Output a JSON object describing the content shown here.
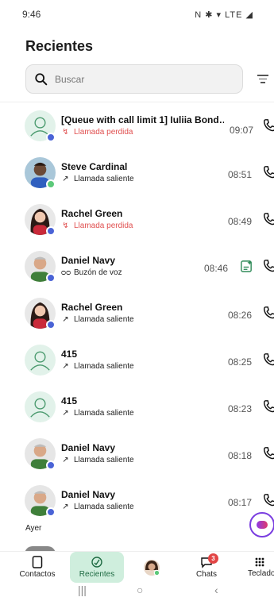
{
  "status_bar": {
    "time": "9:46",
    "indicators": "N ✱ ▾ LTE ◢"
  },
  "page_title": "Recientes",
  "search": {
    "placeholder": "Buscar"
  },
  "calls": [
    {
      "name": "[Queue with call limit 1] Iuliia Bond…",
      "direction": "missed",
      "status": "Llamada perdida",
      "time": "09:07",
      "avatar": "generic",
      "presence": "blue"
    },
    {
      "name": "Steve Cardinal",
      "direction": "outgoing",
      "status": "Llamada saliente",
      "time": "08:51",
      "avatar": "steve",
      "presence": "green"
    },
    {
      "name": "Rachel Green",
      "direction": "missed",
      "status": "Llamada perdida",
      "time": "08:49",
      "avatar": "rachel",
      "presence": "blue"
    },
    {
      "name": "Daniel Navy",
      "direction": "voicemail",
      "status": "Buzón de voz",
      "time": "08:46",
      "avatar": "daniel",
      "presence": "blue"
    },
    {
      "name": "Rachel Green",
      "direction": "outgoing",
      "status": "Llamada saliente",
      "time": "08:26",
      "avatar": "rachel",
      "presence": "blue"
    },
    {
      "name": "415",
      "direction": "outgoing",
      "status": "Llamada saliente",
      "time": "08:25",
      "avatar": "generic",
      "presence": "none"
    },
    {
      "name": "415",
      "direction": "outgoing",
      "status": "Llamada saliente",
      "time": "08:23",
      "avatar": "generic",
      "presence": "none"
    },
    {
      "name": "Daniel Navy",
      "direction": "outgoing",
      "status": "Llamada saliente",
      "time": "08:18",
      "avatar": "daniel",
      "presence": "blue"
    },
    {
      "name": "Daniel Navy",
      "direction": "outgoing",
      "status": "Llamada saliente",
      "time": "08:17",
      "avatar": "daniel",
      "presence": "blue"
    }
  ],
  "section": {
    "yesterday": "Ayer"
  },
  "bottom_nav": {
    "contacts": "Contactos",
    "recents": "Recientes",
    "chats": "Chats",
    "chats_badge": "3",
    "keypad": "Teclado"
  },
  "colors": {
    "accent": "#1f6b43",
    "missed": "#e05050",
    "presence_blue": "#4a63d6",
    "presence_green": "#5cc97a",
    "active_tab_bg": "#cfeedd"
  },
  "icons": {
    "search": "search-icon",
    "filter": "filter-icon",
    "phone": "phone-icon",
    "voicemail": "voicemail-icon",
    "transcript": "transcript-icon"
  }
}
